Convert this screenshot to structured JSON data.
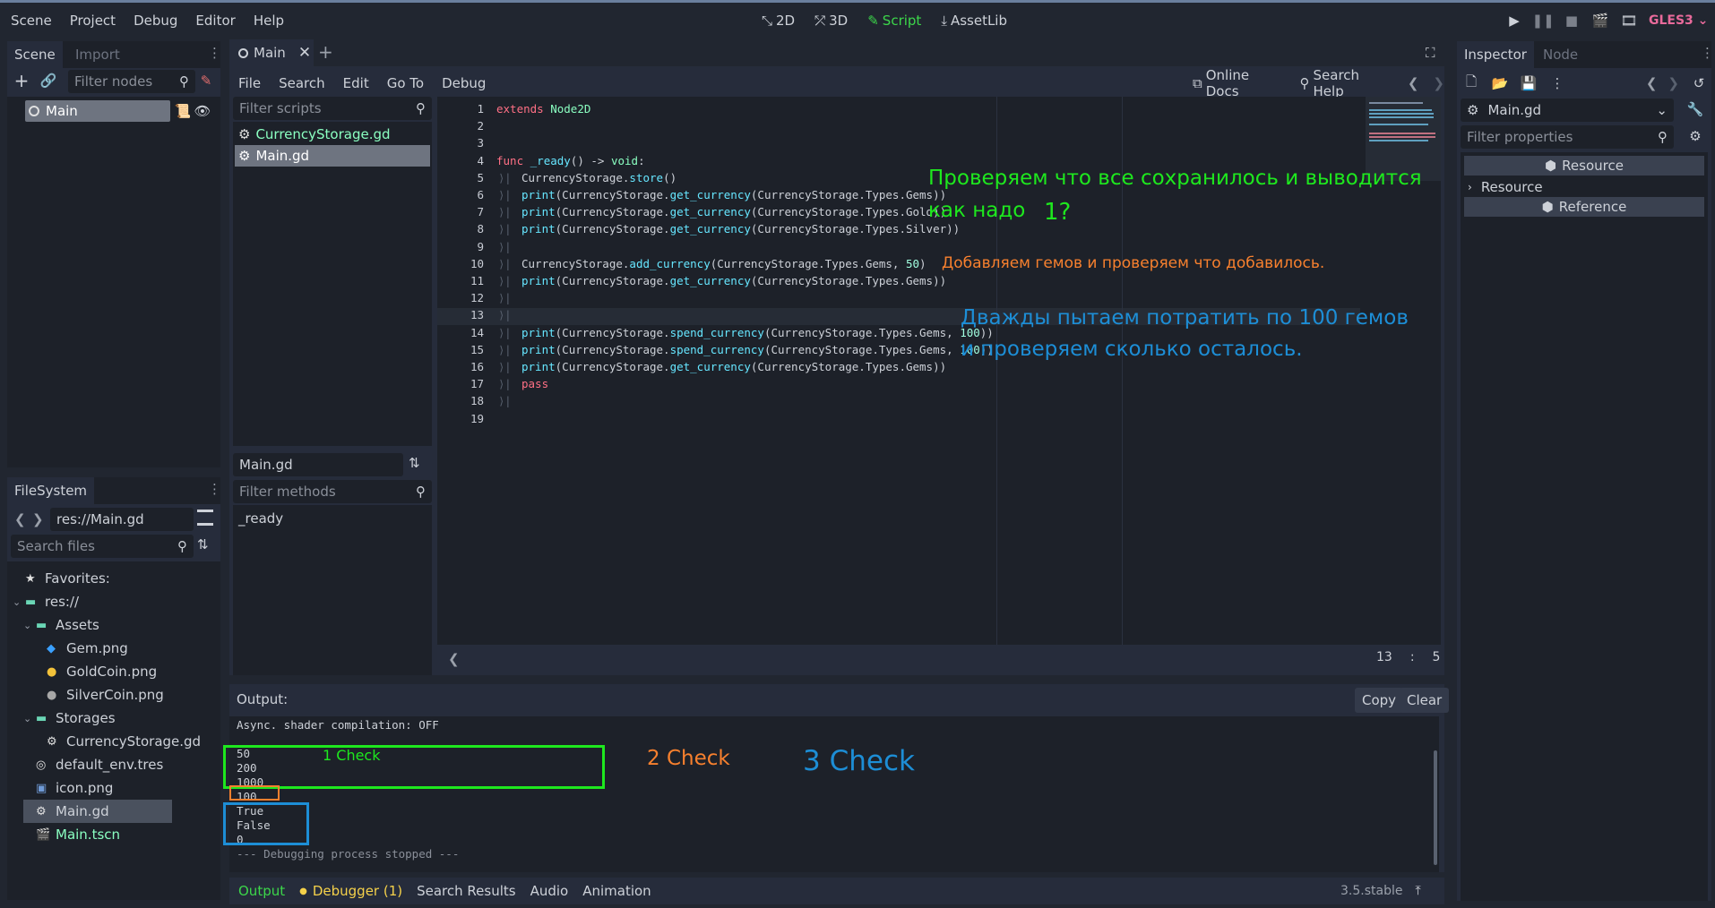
{
  "menu": [
    "Scene",
    "Project",
    "Debug",
    "Editor",
    "Help"
  ],
  "workspaces": [
    {
      "label": "2D",
      "icon": "2d-icon"
    },
    {
      "label": "3D",
      "icon": "3d-icon"
    },
    {
      "label": "Script",
      "icon": "script-icon"
    },
    {
      "label": "AssetLib",
      "icon": "assetlib-icon"
    }
  ],
  "renderer": "GLES3",
  "scene_dock": {
    "tabs": [
      "Scene",
      "Import"
    ],
    "filter_placeholder": "Filter nodes",
    "root_node": "Main"
  },
  "filesystem_dock": {
    "tab": "FileSystem",
    "path": "res://Main.gd",
    "search_placeholder": "Search files",
    "items": [
      {
        "label": "Favorites:",
        "indent": 0,
        "icon": "star-icon",
        "arrow": false
      },
      {
        "label": "res://",
        "indent": 0,
        "icon": "folder-icon",
        "arrow": true
      },
      {
        "label": "Assets",
        "indent": 1,
        "icon": "folder-icon",
        "arrow": true
      },
      {
        "label": "Gem.png",
        "indent": 2,
        "icon": "gem-icon",
        "arrow": false
      },
      {
        "label": "GoldCoin.png",
        "indent": 2,
        "icon": "gold-coin-icon",
        "arrow": false
      },
      {
        "label": "SilverCoin.png",
        "indent": 2,
        "icon": "silver-coin-icon",
        "arrow": false
      },
      {
        "label": "Storages",
        "indent": 1,
        "icon": "folder-icon",
        "arrow": true
      },
      {
        "label": "CurrencyStorage.gd",
        "indent": 2,
        "icon": "gear-icon",
        "arrow": false
      },
      {
        "label": "default_env.tres",
        "indent": 1,
        "icon": "globe-icon",
        "arrow": false
      },
      {
        "label": "icon.png",
        "indent": 1,
        "icon": "image-icon",
        "arrow": false
      },
      {
        "label": "Main.gd",
        "indent": 1,
        "icon": "gear-icon",
        "arrow": false,
        "selected": true
      },
      {
        "label": "Main.tscn",
        "indent": 1,
        "icon": "scene-icon",
        "arrow": false,
        "green": true
      }
    ]
  },
  "editor": {
    "tab": "Main",
    "menu": [
      "File",
      "Search",
      "Edit",
      "Go To",
      "Debug"
    ],
    "online_docs": "Online Docs",
    "search_help": "Search Help",
    "filter_scripts_placeholder": "Filter scripts",
    "scripts": [
      "CurrencyStorage.gd",
      "Main.gd"
    ],
    "current_script": "Main.gd",
    "filter_methods_placeholder": "Filter methods",
    "methods": [
      "_ready"
    ],
    "cursor_line": "13",
    "cursor_col": "5",
    "code_lines": [
      "extends Node2D",
      "",
      "",
      "func _ready() -> void:",
      "    CurrencyStorage.store()",
      "    print(CurrencyStorage.get_currency(CurrencyStorage.Types.Gems))",
      "    print(CurrencyStorage.get_currency(CurrencyStorage.Types.Gold))",
      "    print(CurrencyStorage.get_currency(CurrencyStorage.Types.Silver))",
      "",
      "    CurrencyStorage.add_currency(CurrencyStorage.Types.Gems, 50)",
      "    print(CurrencyStorage.get_currency(CurrencyStorage.Types.Gems))",
      "",
      "",
      "    print(CurrencyStorage.spend_currency(CurrencyStorage.Types.Gems, 100))",
      "    print(CurrencyStorage.spend_currency(CurrencyStorage.Types.Gems, 100))",
      "    print(CurrencyStorage.get_currency(CurrencyStorage.Types.Gems))",
      "    pass",
      "",
      ""
    ],
    "annotations": {
      "green_line1": "Проверяем что все сохранилось и выводится",
      "green_line2": "как надо",
      "green_num": "1?",
      "orange": "Добавляем гемов и проверяем что добавилось.",
      "blue_line1": "Дважды пытаем потратить по 100 гемов",
      "blue_line2": "и проверяем сколько осталось."
    }
  },
  "inspector": {
    "tabs": [
      "Inspector",
      "Node"
    ],
    "object": "Main.gd",
    "filter_placeholder": "Filter properties",
    "section_resource": "Resource",
    "resource_row": "Resource",
    "section_reference": "Reference"
  },
  "output": {
    "title": "Output:",
    "copy": "Copy",
    "clear": "Clear",
    "lines": [
      "Async. shader compilation: OFF",
      "",
      "50",
      "200",
      "1000",
      "100",
      "True",
      "False",
      "0",
      "--- Debugging process stopped ---"
    ],
    "check1": "1 Check",
    "check2": "2 Check",
    "check3": "3 Check"
  },
  "bottom_tabs": [
    "Output",
    "Debugger (1)",
    "Search Results",
    "Audio",
    "Animation"
  ],
  "version": "3.5.stable",
  "colors": {
    "accent_green": "#3cd64a",
    "annotation_green": "#1ee81e",
    "annotation_orange": "#f7802e",
    "annotation_blue": "#1d8ed6"
  }
}
